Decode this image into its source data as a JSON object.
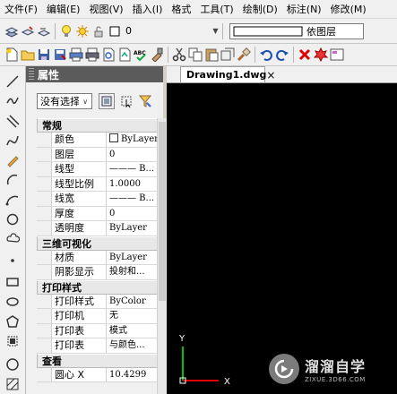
{
  "menu": [
    "文件(F)",
    "编辑(E)",
    "视图(V)",
    "插入(I)",
    "格式",
    "工具(T)",
    "绘制(D)",
    "标注(N)",
    "修改(M)"
  ],
  "toolbar1": {
    "layer_value": "0",
    "layer_combo_value": "依图层"
  },
  "properties_panel": {
    "title": "属性",
    "selection_value": "没有选择",
    "categories": [
      {
        "name": "常规",
        "toggle": "▲",
        "rows": [
          {
            "key": "颜色",
            "value": "ByLayer",
            "swatch": true
          },
          {
            "key": "图层",
            "value": "0"
          },
          {
            "key": "线型",
            "value": "——— B..."
          },
          {
            "key": "线型比例",
            "value": "1.0000"
          },
          {
            "key": "线宽",
            "value": "——— B..."
          },
          {
            "key": "厚度",
            "value": "0"
          },
          {
            "key": "透明度",
            "value": "ByLayer"
          }
        ]
      },
      {
        "name": "三维可视化",
        "toggle": "▲",
        "rows": [
          {
            "key": "材质",
            "value": "ByLayer"
          },
          {
            "key": "阴影显示",
            "value": "投射和..."
          }
        ]
      },
      {
        "name": "打印样式",
        "toggle": "▲",
        "rows": [
          {
            "key": "打印样式",
            "value": "ByColor"
          },
          {
            "key": "打印机",
            "value": "无"
          },
          {
            "key": "打印表",
            "value": "模式"
          },
          {
            "key": "打印表",
            "value": "与颜色..."
          }
        ]
      },
      {
        "name": "查看",
        "toggle": "▲",
        "rows": [
          {
            "key": "圆心 X",
            "value": "10.4299"
          }
        ]
      }
    ]
  },
  "document": {
    "tab_label": "Drawing1.dwg",
    "tab_close": "×",
    "ucs_x_label": "X",
    "ucs_y_label": "Y"
  },
  "watermark": {
    "title": "溜溜自学",
    "url": "ZIXUE.3D66.COM"
  },
  "colors": {
    "canvas": "#000000",
    "panel_title_bg": "#5b5b5b",
    "ucs_green": "#00c000",
    "ucs_red": "#e00000"
  }
}
